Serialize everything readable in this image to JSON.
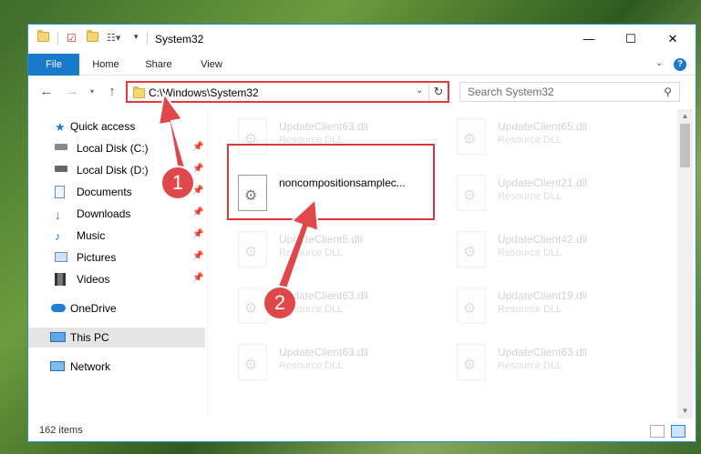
{
  "window": {
    "title": "System32",
    "min_glyph": "—",
    "max_glyph": "☐",
    "close_glyph": "✕"
  },
  "ribbon": {
    "tabs": [
      "File",
      "Home",
      "Share",
      "View"
    ],
    "accent": "#1979ca"
  },
  "address": {
    "path": "C:\\Windows\\System32",
    "search_placeholder": "Search System32"
  },
  "sidebar": {
    "items": [
      {
        "label": "Quick access",
        "icon": "star-icon",
        "pinned": false
      },
      {
        "label": "Local Disk (C:)",
        "icon": "drive-icon",
        "pinned": true
      },
      {
        "label": "Local Disk (D:)",
        "icon": "drive-icon",
        "pinned": true
      },
      {
        "label": "Documents",
        "icon": "documents-icon",
        "pinned": true
      },
      {
        "label": "Downloads",
        "icon": "download-icon",
        "pinned": true
      },
      {
        "label": "Music",
        "icon": "music-icon",
        "pinned": true
      },
      {
        "label": "Pictures",
        "icon": "pictures-icon",
        "pinned": true
      },
      {
        "label": "Videos",
        "icon": "videos-icon",
        "pinned": true
      },
      {
        "label": "OneDrive",
        "icon": "cloud-icon",
        "pinned": false
      },
      {
        "label": "This PC",
        "icon": "computer-icon",
        "pinned": false,
        "selected": true
      },
      {
        "label": "Network",
        "icon": "network-icon",
        "pinned": false
      }
    ]
  },
  "files": [
    {
      "name": "UpdateClient63.dll",
      "type": "Resource DLL"
    },
    {
      "name": "UpdateClient65.dll",
      "type": "Resource DLL"
    },
    {
      "name": "noncompositionsamplec...",
      "type": "",
      "highlighted": true
    },
    {
      "name": "UpdateClient21.dll",
      "type": "Resource DLL"
    },
    {
      "name": "UpdateClient5.dll",
      "type": "Resource DLL"
    },
    {
      "name": "UpdateClient42.dll",
      "type": "Resource DLL"
    },
    {
      "name": "UpdateClient63.dll",
      "type": "Resource DLL"
    },
    {
      "name": "UpdateClient19.dll",
      "type": "Resource DLL"
    },
    {
      "name": "UpdateClient63.dll",
      "type": "Resource DLL"
    },
    {
      "name": "UpdateClient63.dll",
      "type": "Resource DLL"
    }
  ],
  "status": {
    "item_count": "162 items"
  },
  "annotations": {
    "step1": "1",
    "step2": "2",
    "color": "#e0474a"
  }
}
